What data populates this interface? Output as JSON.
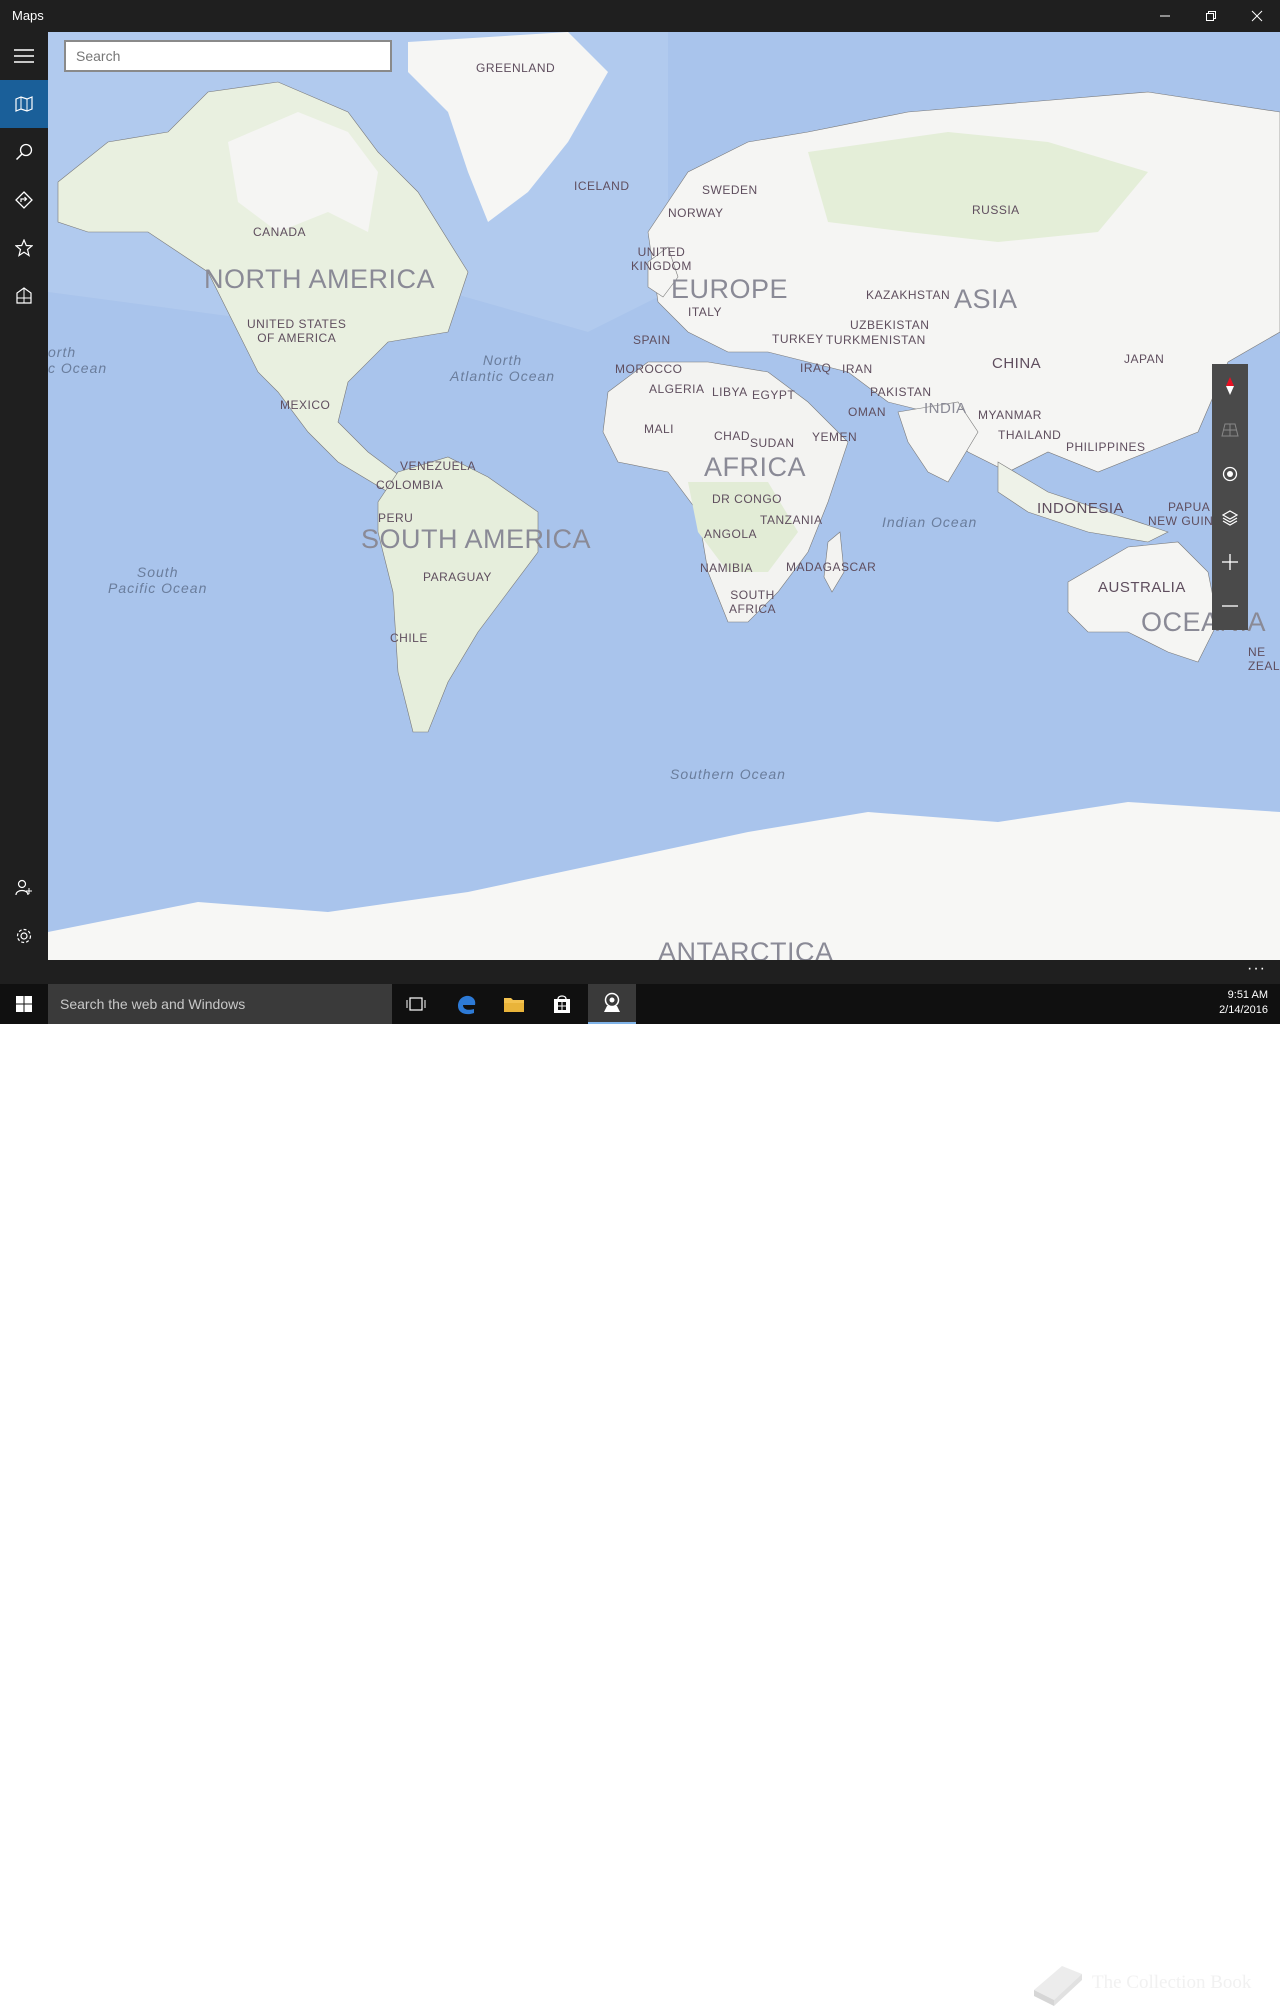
{
  "window": {
    "title": "Maps",
    "minimize_label": "Minimize",
    "maximize_label": "Restore",
    "close_label": "Close"
  },
  "search": {
    "placeholder": "Search",
    "value": ""
  },
  "map": {
    "colors": {
      "water": "#a9c4ec",
      "land": "#f5f5f3",
      "vegetation": "#e2eed6",
      "border": "#6b6b6b"
    },
    "continents": {
      "north_america": "NORTH AMERICA",
      "south_america": "SOUTH AMERICA",
      "europe": "EUROPE",
      "asia": "ASIA",
      "africa": "AFRICA",
      "oceania": "OCEANIA",
      "antarctica": "ANTARCTICA"
    },
    "oceans": {
      "north_atlantic": "North\nAtlantic Ocean",
      "south_pacific": "South\nPacific Ocean",
      "north_pacific": "orth\nc Ocean",
      "indian": "Indian Ocean",
      "southern": "Southern Ocean"
    },
    "countries": {
      "greenland": "GREENLAND",
      "iceland": "ICELAND",
      "canada": "CANADA",
      "usa": "UNITED STATES\nOF AMERICA",
      "mexico": "MEXICO",
      "venezuela": "VENEZUELA",
      "colombia": "COLOMBIA",
      "peru": "PERU",
      "paraguay": "PARAGUAY",
      "chile": "CHILE",
      "sweden": "SWEDEN",
      "norway": "NORWAY",
      "uk": "UNITED\nKINGDOM",
      "italy": "ITALY",
      "spain": "SPAIN",
      "morocco": "MOROCCO",
      "algeria": "ALGERIA",
      "libya": "LIBYA",
      "egypt": "EGYPT",
      "mali": "MALI",
      "chad": "CHAD",
      "sudan": "SUDAN",
      "yemen": "YEMEN",
      "dr_congo": "DR CONGO",
      "tanzania": "TANZANIA",
      "angola": "ANGOLA",
      "namibia": "NAMIBIA",
      "madagascar": "MADAGASCAR",
      "south_africa": "SOUTH\nAFRICA",
      "russia": "RUSSIA",
      "kazakhstan": "KAZAKHSTAN",
      "uzbekistan": "UZBEKISTAN",
      "turkmenistan": "TURKMENISTAN",
      "turkey": "TURKEY",
      "iraq": "IRAQ",
      "iran": "IRAN",
      "pakistan": "PAKISTAN",
      "oman": "OMAN",
      "india": "INDIA",
      "china": "CHINA",
      "japan": "JAPAN",
      "myanmar": "MYANMAR",
      "thailand": "THAILAND",
      "philippines": "PHILIPPINES",
      "indonesia": "INDONESIA",
      "papua_new_guinea": "PAPUA\nNEW GUINEA",
      "australia": "AUSTRALIA",
      "new_zealand": "NE\nZEAL"
    }
  },
  "sidebar": {
    "items": [
      {
        "name": "menu",
        "icon": "hamburger-icon"
      },
      {
        "name": "map",
        "icon": "map-icon"
      },
      {
        "name": "search",
        "icon": "search-icon"
      },
      {
        "name": "directions",
        "icon": "directions-icon"
      },
      {
        "name": "favorites",
        "icon": "star-icon"
      },
      {
        "name": "3d-cities",
        "icon": "3d-cities-icon"
      },
      {
        "name": "sign-in",
        "icon": "add-user-icon"
      },
      {
        "name": "settings",
        "icon": "gear-icon"
      }
    ]
  },
  "map_controls": [
    "compass-icon",
    "tilt-icon",
    "location-icon",
    "layers-icon",
    "zoom-in-icon",
    "zoom-out-icon"
  ],
  "app_bar": {
    "more_label": "···"
  },
  "taskbar": {
    "search_placeholder": "Search the web and Windows",
    "time": "9:51 AM",
    "date": "2/14/2016",
    "watermark": "The Collection Book"
  }
}
